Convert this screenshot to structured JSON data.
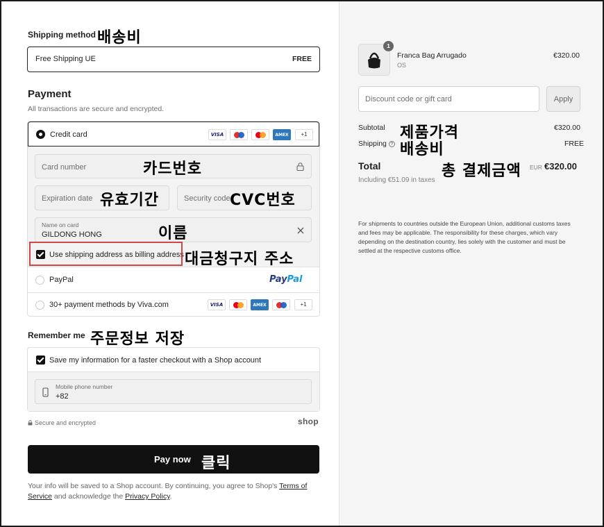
{
  "left": {
    "shipping_method": {
      "title": "Shipping method",
      "annotation": "배송비",
      "option_name": "Free Shipping UE",
      "option_price": "FREE"
    },
    "payment": {
      "title": "Payment",
      "subtitle": "All transactions are secure and encrypted.",
      "credit_card_label": "Credit card",
      "card_brands": [
        "visa",
        "maestro",
        "mastercard",
        "amex"
      ],
      "more_badge": "+1",
      "card_number_placeholder": "Card number",
      "card_number_annotation": "카드번호",
      "expiration_placeholder": "Expiration date",
      "expiration_annotation": "유효기간",
      "security_placeholder": "Security code",
      "security_annotation": "CVC번호",
      "name_label": "Name on card",
      "name_value": "GILDONG HONG",
      "name_annotation": "이름",
      "billing_label": "Use shipping address as billing address",
      "billing_annotation": "대금청구지 주소",
      "paypal_label": "PayPal",
      "paypal_logo_a": "Pay",
      "paypal_logo_b": "Pal",
      "viva_label": "30+ payment methods by Viva.com",
      "viva_brands": [
        "visa",
        "mastercard",
        "amex",
        "maestro"
      ],
      "viva_more_badge": "+1"
    },
    "remember": {
      "title": "Remember me",
      "annotation": "주문정보 저장",
      "save_label": "Save my information for a faster checkout with a Shop account",
      "phone_label": "Mobile phone number",
      "phone_value": "+82"
    },
    "secure_text": "Secure and encrypted",
    "shop_logo": "shop",
    "pay_button": "Pay now",
    "pay_annotation": "클릭",
    "terms": {
      "prefix": "Your info will be saved to a Shop account. By continuing, you agree to Shop's ",
      "terms_link": "Terms of Service",
      "middle": " and acknowledge the ",
      "privacy_link": "Privacy Policy",
      "suffix": "."
    }
  },
  "right": {
    "product": {
      "name": "Franca Bag Arrugado",
      "variant": "OS",
      "price": "€320.00",
      "quantity": "1"
    },
    "discount_placeholder": "Discount code or gift card",
    "apply_label": "Apply",
    "subtotal_label": "Subtotal",
    "subtotal_annotation": "제품가격",
    "subtotal_value": "€320.00",
    "shipping_label": "Shipping",
    "shipping_annotation": "배송비",
    "shipping_value": "FREE",
    "total_label": "Total",
    "total_annotation": "총 결제금액",
    "total_currency": "EUR",
    "total_value": "€320.00",
    "taxes_note": "Including €51.09 in taxes",
    "customs_note": "For shipments to countries outside the European Union, additional customs taxes and fees may be applicable. The responsibility for these charges, which vary depending on the destination country, lies solely with the customer and must be settled at the respective customs office."
  },
  "colors": {
    "highlight_border": "#d14545",
    "pay_button_bg": "#111111",
    "right_panel_bg": "#f5f5f5"
  }
}
